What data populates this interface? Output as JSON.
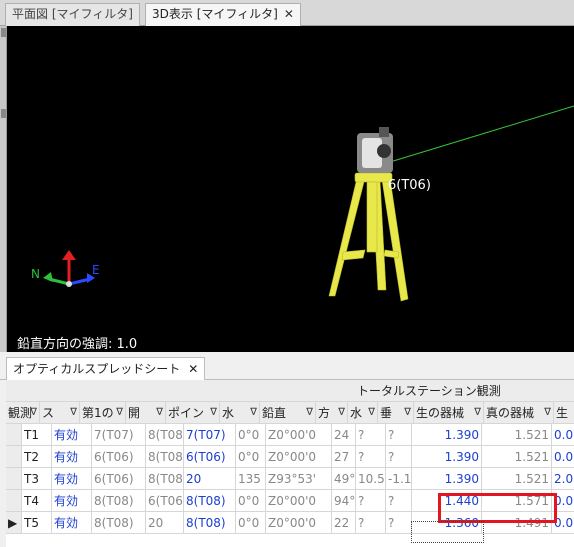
{
  "window_tabs": [
    {
      "label": "平面図 [マイフィルタ]",
      "active": false
    },
    {
      "label": "3D表示 [マイフィルタ]",
      "active": true
    }
  ],
  "close_glyph": "✕",
  "viewport": {
    "point_label": "6(T06)",
    "emphasis_label": "鉛直方向の強調: 1.0",
    "axis_labels": {
      "north": "N",
      "east": "E"
    },
    "colors": {
      "background": "#000000",
      "tripod": "#e8e84a",
      "sight_line": "#37c837",
      "axis_north": "#2fbf3a",
      "axis_up": "#e32020",
      "axis_east": "#2a4bff"
    }
  },
  "panel": {
    "tab_label": "オプティカルスプレッドシート",
    "group_header": "トータルステーション観測",
    "filter_glyph": "∇",
    "columns": [
      "観測",
      "ス",
      "第1の",
      "開",
      "ポイン",
      "水",
      "鉛直",
      "方",
      "水",
      "垂",
      "生の器械",
      "真の器械",
      "生"
    ],
    "rows": [
      {
        "marker": "",
        "cells": [
          "T1",
          "有効",
          "7(T07)",
          "8(T08",
          "7(T07)",
          "0°0",
          "Z0°00'0",
          "24",
          "?",
          "?",
          "1.390",
          "1.521",
          "0.0"
        ]
      },
      {
        "marker": "",
        "cells": [
          "T2",
          "有効",
          "6(T06)",
          "8(T08",
          "6(T06)",
          "0°0",
          "Z0°00'0",
          "27",
          "?",
          "?",
          "1.390",
          "1.521",
          "0.0"
        ]
      },
      {
        "marker": "",
        "cells": [
          "T3",
          "有効",
          "6(T06)",
          "8(T08",
          "20",
          "135",
          "Z93°53'",
          "49°",
          "10.5",
          "-1.1",
          "1.390",
          "1.521",
          "2.0"
        ]
      },
      {
        "marker": "",
        "cells": [
          "T4",
          "有効",
          "8(T08)",
          "6(T06",
          "8(T08)",
          "0°0",
          "Z0°00'0",
          "94°",
          "?",
          "?",
          "1.440",
          "1.571",
          "0.0"
        ]
      },
      {
        "marker": "▶",
        "cells": [
          "T5",
          "有効",
          "8(T08)",
          "20",
          "8(T08)",
          "0°0",
          "Z0°00'0",
          "22",
          "?",
          "?",
          "1.360",
          "1.491",
          "0.0"
        ]
      }
    ],
    "colors": {
      "link": "#1c3fd0",
      "highlight": "#e3161f"
    }
  }
}
